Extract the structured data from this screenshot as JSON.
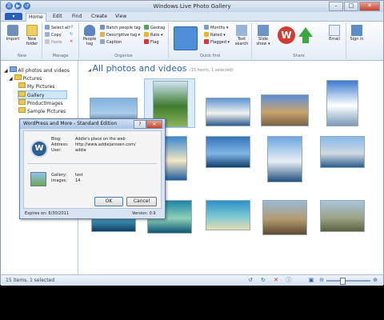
{
  "window": {
    "title": "Windows Live Photo Gallery",
    "min": "–",
    "max": "□",
    "close": "✕"
  },
  "qat": [
    "☰",
    "▶",
    "↺"
  ],
  "tabs": {
    "file": "▾",
    "items": [
      "Home",
      "Edit",
      "Find",
      "Create",
      "View"
    ]
  },
  "ribbon": {
    "new_group": {
      "label": "New",
      "import": "Import",
      "new_folder": "New folder"
    },
    "manage_group": {
      "label": "Manage",
      "select_all": "Select all",
      "copy": "Copy",
      "paste": "Paste"
    },
    "organize_group": {
      "label": "Organize",
      "people_tag": "People tag",
      "batch_people_tag": "Batch people tag",
      "descriptive_tag": "Descriptive tag",
      "caption": "Caption",
      "geotag": "Geotag",
      "rate": "Rate",
      "flag": "Flag"
    },
    "quickfind_group": {
      "label": "Quick find",
      "months": "Months",
      "rated": "Rated",
      "flagged": "Flagged",
      "text_search": "Text search"
    },
    "share_group": {
      "label": "Share",
      "slide_show": "Slide show",
      "email": "Email",
      "sign_in": "Sign in"
    }
  },
  "nav": {
    "items": [
      {
        "label": "All photos and videos"
      },
      {
        "label": "Pictures"
      },
      {
        "label": "My Pictures"
      },
      {
        "label": "Gallery"
      },
      {
        "label": "ProductImages"
      },
      {
        "label": "Sample Pictures"
      }
    ]
  },
  "content": {
    "heading": "All photos and videos",
    "count": "(15 items, 1 selected)"
  },
  "photos": [
    {
      "subject": "city-skyline"
    },
    {
      "subject": "topiary-trees"
    },
    {
      "subject": "opera-house"
    },
    {
      "subject": "cathedral"
    },
    {
      "subject": "lighthouse"
    },
    {
      "subject": "coast"
    },
    {
      "subject": "beach"
    },
    {
      "subject": "ocean"
    },
    {
      "subject": "boat-wake"
    },
    {
      "subject": "boat-deck"
    },
    {
      "subject": "aerial-reef"
    },
    {
      "subject": "reef-island"
    },
    {
      "subject": "island-aerial"
    },
    {
      "subject": "plane-over-desert"
    },
    {
      "subject": "plane-over-plains"
    }
  ],
  "status": {
    "text": "15 items, 1 selected"
  },
  "dialog": {
    "title": "WordPress and More - Standard Edition",
    "help_btn": "?",
    "close_btn": "✕",
    "blog_label": "Blog:",
    "blog_value": "Addie's place on the web",
    "address_label": "Address:",
    "address_value": "http://www.addiejanssen.com/",
    "user_label": "User:",
    "user_value": "addie",
    "gallery_label": "Gallery:",
    "gallery_value": "test",
    "images_label": "Images:",
    "images_value": "14",
    "ok": "OK",
    "cancel": "Cancel",
    "expires": "Expires on: 6/30/2011",
    "version": "Version: 0.9"
  }
}
